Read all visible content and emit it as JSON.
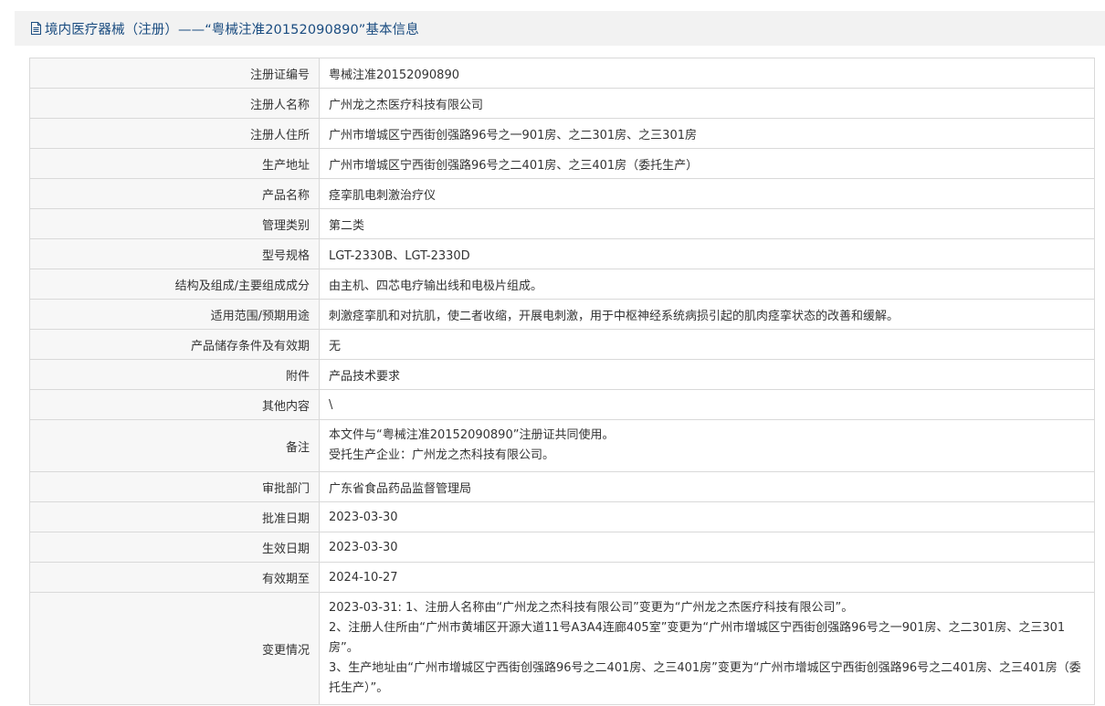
{
  "header": {
    "icon": "document-icon",
    "title": "境内医疗器械（注册）——“粤械注准20152090890”基本信息"
  },
  "colors": {
    "title": "#1a4c80",
    "header_bg": "#f2f2f2",
    "label_bg": "#f7f7f7",
    "border": "#d9d9d9",
    "text": "#333333"
  },
  "rows": [
    {
      "label": "注册证编号",
      "value": "粤械注准20152090890"
    },
    {
      "label": "注册人名称",
      "value": "广州龙之杰医疗科技有限公司"
    },
    {
      "label": "注册人住所",
      "value": "广州市增城区宁西街创强路96号之一901房、之二301房、之三301房"
    },
    {
      "label": "生产地址",
      "value": "广州市增城区宁西街创强路96号之二401房、之三401房（委托生产）"
    },
    {
      "label": "产品名称",
      "value": "痉挛肌电刺激治疗仪"
    },
    {
      "label": "管理类别",
      "value": "第二类"
    },
    {
      "label": "型号规格",
      "value": "LGT-2330B、LGT-2330D"
    },
    {
      "label": "结构及组成/主要组成成分",
      "value": "由主机、四芯电疗输出线和电极片组成。"
    },
    {
      "label": "适用范围/预期用途",
      "value": "刺激痉挛肌和对抗肌，使二者收缩，开展电刺激，用于中枢神经系统病损引起的肌肉痉挛状态的改善和缓解。"
    },
    {
      "label": "产品储存条件及有效期",
      "value": "无"
    },
    {
      "label": "附件",
      "value": "产品技术要求"
    },
    {
      "label": "其他内容",
      "value": "\\"
    },
    {
      "label": "备注",
      "lines": [
        "本文件与“粤械注准20152090890”注册证共同使用。",
        "受托生产企业：广州龙之杰科技有限公司。"
      ]
    },
    {
      "label": "审批部门",
      "value": "广东省食品药品监督管理局"
    },
    {
      "label": "批准日期",
      "value": "2023-03-30"
    },
    {
      "label": "生效日期",
      "value": "2023-03-30"
    },
    {
      "label": "有效期至",
      "value": "2024-10-27"
    },
    {
      "label": "变更情况",
      "lines": [
        "2023-03-31: 1、注册人名称由“广州龙之杰科技有限公司”变更为“广州龙之杰医疗科技有限公司”。",
        "2、注册人住所由“广州市黄埔区开源大道11号A3A4连廊405室”变更为“广州市增城区宁西街创强路96号之一901房、之二301房、之三301房”。",
        "3、生产地址由“广州市增城区宁西街创强路96号之二401房、之三401房”变更为“广州市增城区宁西街创强路96号之二401房、之三401房（委托生产）”。"
      ]
    }
  ]
}
